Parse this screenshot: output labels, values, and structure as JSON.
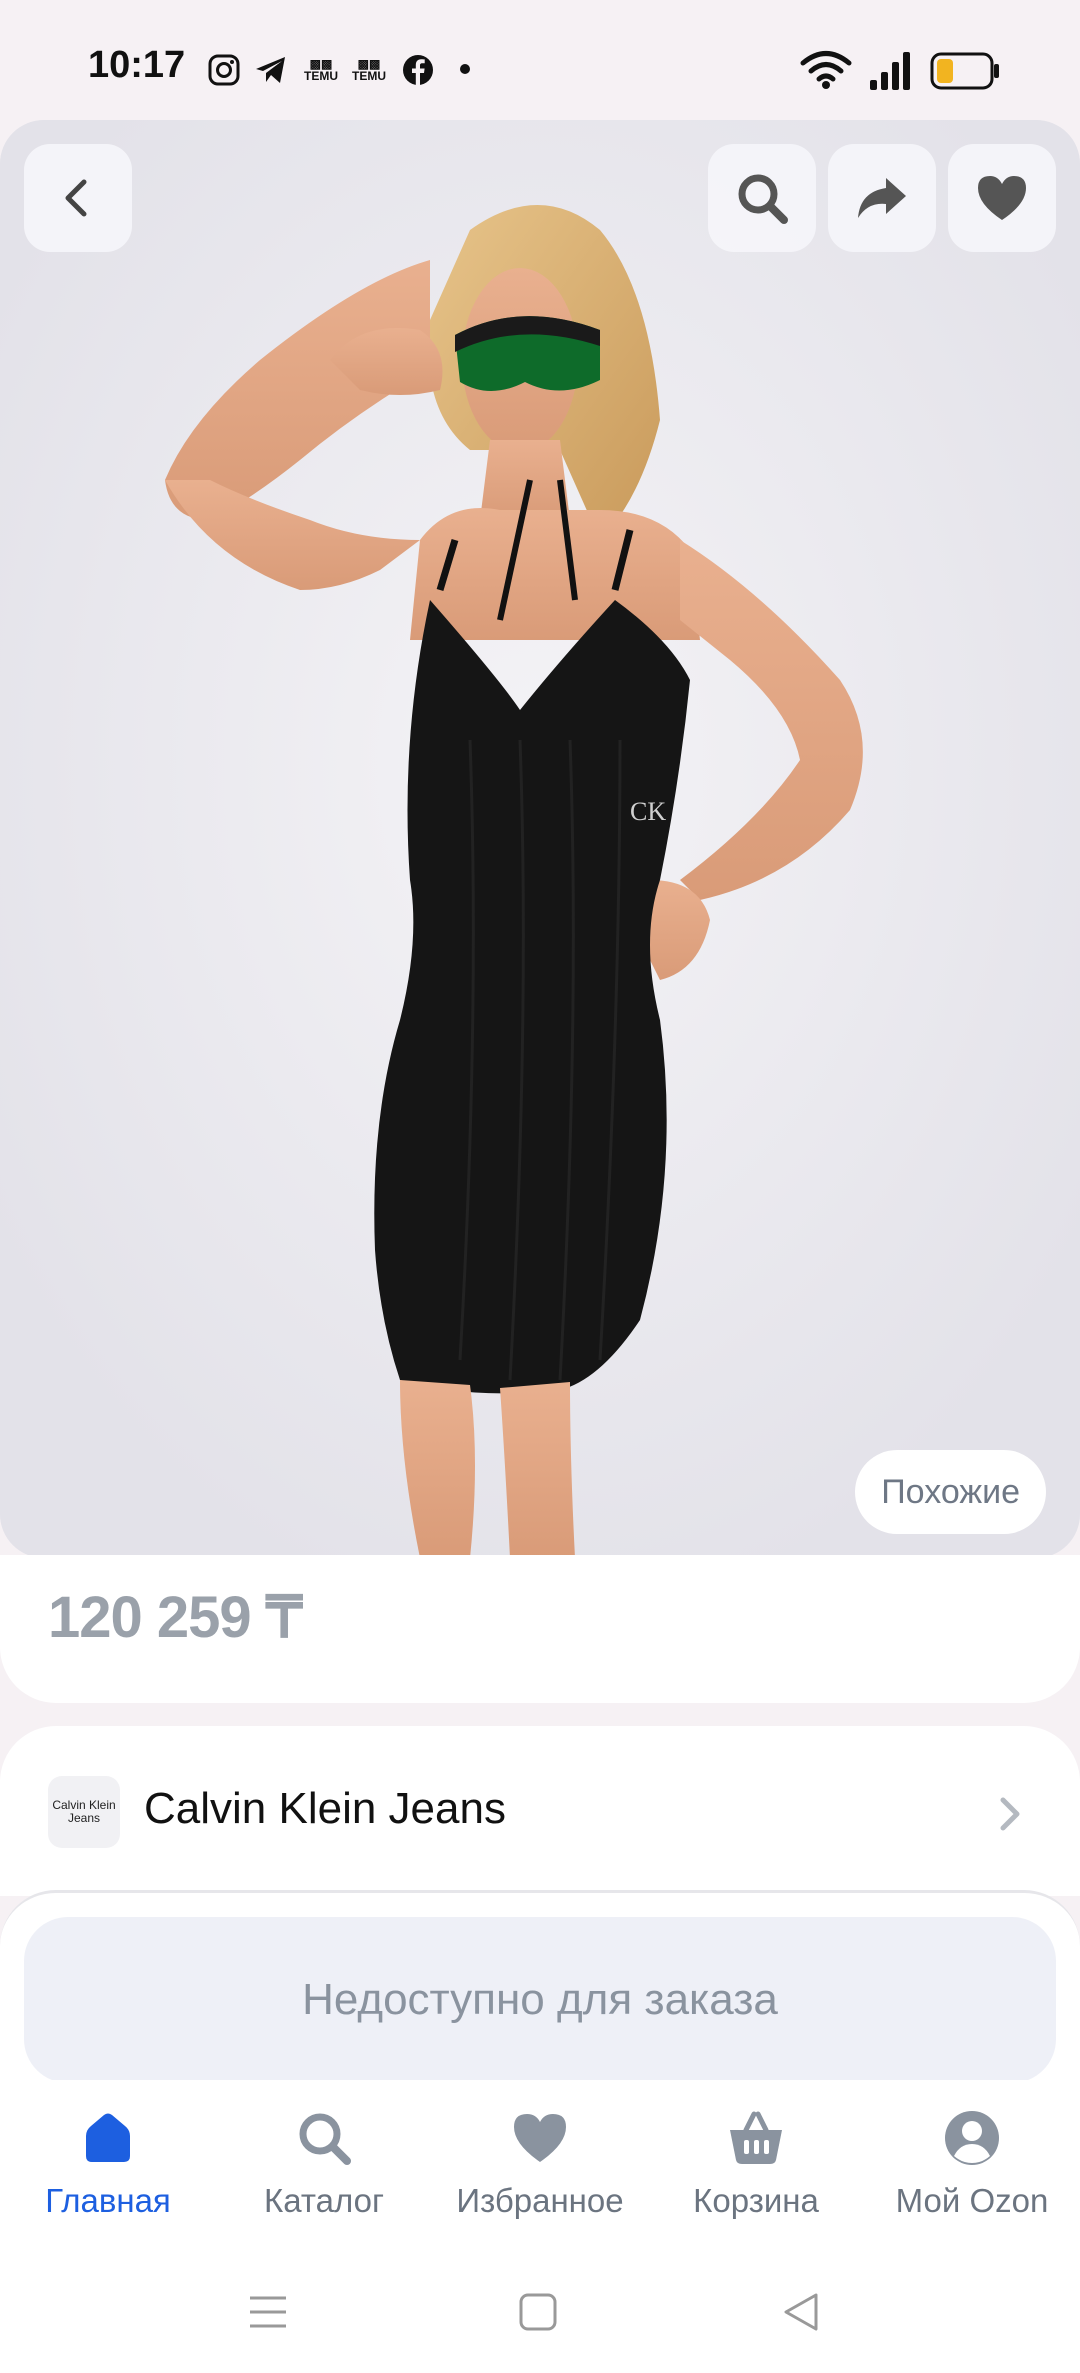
{
  "status_bar": {
    "time": "10:17",
    "apps": [
      "instagram-icon",
      "telegram-icon",
      "temu-icon",
      "temu-icon",
      "facebook-icon",
      "dot-icon"
    ],
    "temu_label": "TEMU",
    "battery_color": "#f2b420"
  },
  "hero": {
    "similar_label": "Похожие",
    "back_icon": "chevron-left-icon",
    "actions": [
      "search-icon",
      "share-icon",
      "heart-icon"
    ],
    "photo_logo": "CK"
  },
  "product": {
    "price": "120 259 ₸"
  },
  "brand": {
    "logo_line1": "Calvin Klein",
    "logo_line2": "Jeans",
    "name": "Calvin Klein Jeans"
  },
  "order": {
    "label": "Недоступно для заказа"
  },
  "bottom_nav": {
    "items": [
      {
        "label": "Главная",
        "icon": "home-icon",
        "active": true
      },
      {
        "label": "Каталог",
        "icon": "search-icon",
        "active": false
      },
      {
        "label": "Избранное",
        "icon": "heart-icon",
        "active": false
      },
      {
        "label": "Корзина",
        "icon": "basket-icon",
        "active": false
      },
      {
        "label": "Мой Ozon",
        "icon": "profile-icon",
        "active": false
      }
    ]
  },
  "colors": {
    "accent": "#1d5fe0",
    "inactive": "#6b7480",
    "price": "#9aa1aa"
  }
}
